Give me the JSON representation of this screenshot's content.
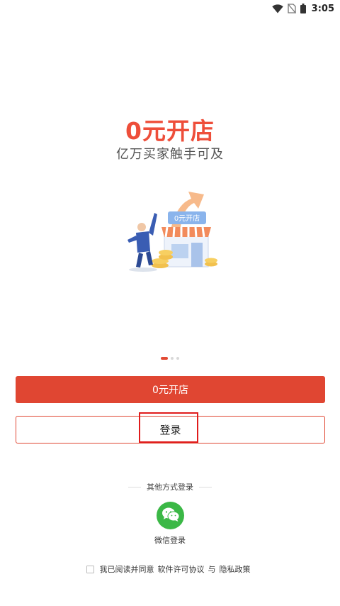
{
  "status_bar": {
    "time": "3:05",
    "icons": [
      "wifi-icon",
      "no-sim-icon",
      "battery-icon"
    ]
  },
  "hero": {
    "title": "0元开店",
    "subtitle": "亿万买家触手可及",
    "illustration_sign": "0元开店"
  },
  "pager": {
    "count": 3,
    "active_index": 0
  },
  "buttons": {
    "open_store": "0元开店",
    "login": "登录"
  },
  "other_login": {
    "title": "其他方式登录",
    "wechat_label": "微信登录"
  },
  "agreement": {
    "prefix": "我已阅读并同意",
    "license": "软件许可协议",
    "joiner": "与",
    "privacy": "隐私政策",
    "checked": false
  },
  "colors": {
    "brand_red": "#e04632",
    "title_red": "#ee4e3a",
    "wechat_green": "#3bb846",
    "highlight": "#e01c1c"
  }
}
